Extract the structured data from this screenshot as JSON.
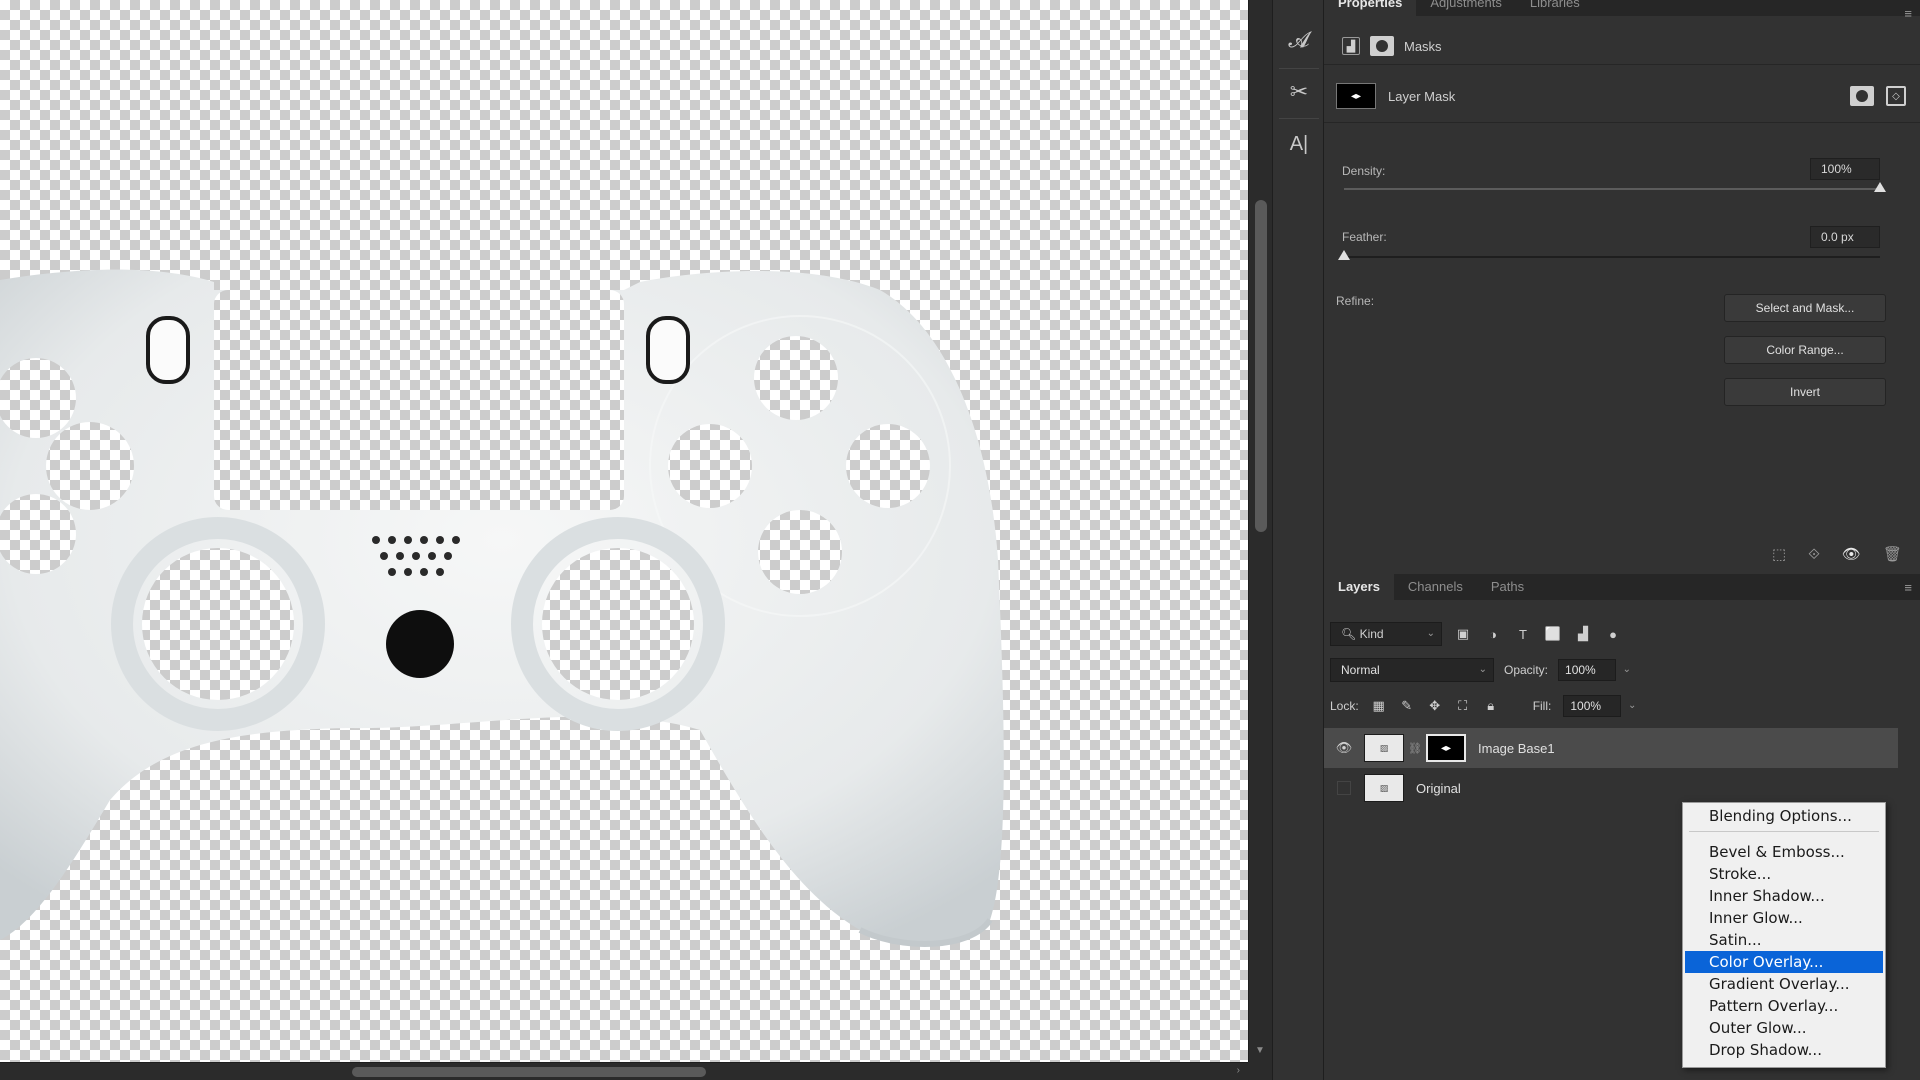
{
  "toolbar_tools": [
    {
      "name": "character-style-icon",
      "glyph": "𝓐"
    },
    {
      "name": "scissors-icon",
      "glyph": "✂"
    },
    {
      "name": "paragraph-type-icon",
      "glyph": "A|"
    }
  ],
  "properties": {
    "tabs": [
      "Properties",
      "Adjustments",
      "Libraries"
    ],
    "section_label": "Masks",
    "layer_mask_label": "Layer Mask",
    "density_label": "Density:",
    "density_value": "100%",
    "density_level": 1.0,
    "feather_label": "Feather:",
    "feather_value": "0.0 px",
    "feather_level": 0.0,
    "refine_label": "Refine:",
    "buttons": [
      "Select and Mask...",
      "Color Range...",
      "Invert"
    ]
  },
  "layers": {
    "tabs": [
      "Layers",
      "Channels",
      "Paths"
    ],
    "kind_label": "Kind",
    "blend_mode": "Normal",
    "opacity_label": "Opacity:",
    "opacity_value": "100%",
    "lock_label": "Lock:",
    "fill_label": "Fill:",
    "fill_value": "100%",
    "items": [
      {
        "name": "Image Base1",
        "visible": true,
        "selected": true
      },
      {
        "name": "Original",
        "visible": false,
        "selected": false
      }
    ]
  },
  "context_menu": {
    "items": [
      "Blending Options...",
      "Bevel & Emboss...",
      "Stroke...",
      "Inner Shadow...",
      "Inner Glow...",
      "Satin...",
      "Color Overlay...",
      "Gradient Overlay...",
      "Pattern Overlay...",
      "Outer Glow...",
      "Drop Shadow..."
    ],
    "highlighted": "Color Overlay..."
  },
  "colors": {
    "panel_bg": "#323232",
    "menu_highlight": "#0a64d8",
    "controller_body": "#eef0f0"
  }
}
